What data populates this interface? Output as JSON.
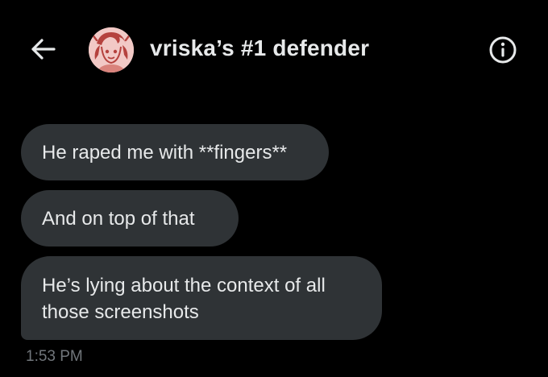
{
  "header": {
    "back_icon": "arrow-left-icon",
    "avatar_alt": "profile picture",
    "title": "vriska’s #1 defender",
    "info_icon": "info-icon"
  },
  "messages": [
    {
      "text": "He raped me with **fingers**"
    },
    {
      "text": "And on top of that"
    },
    {
      "text": "He’s lying about the context of all those screenshots"
    }
  ],
  "timestamp": "1:53 PM",
  "colors": {
    "background": "#000000",
    "bubble": "#2f3336",
    "text": "#e7e9ea",
    "muted": "#71767b",
    "avatar_bg": "#f2c9c6",
    "avatar_line": "#b5423e"
  }
}
